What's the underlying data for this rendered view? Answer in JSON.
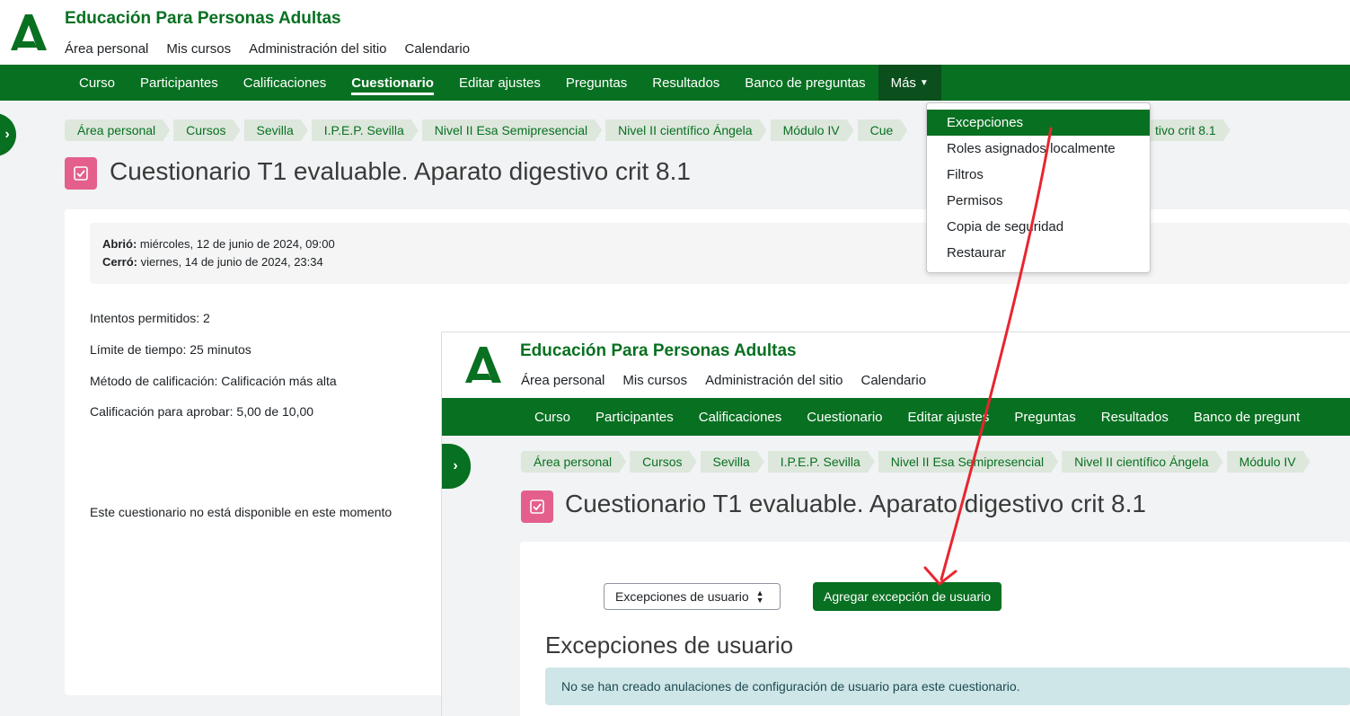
{
  "site": {
    "title": "Educación Para Personas Adultas"
  },
  "topnav": [
    "Área personal",
    "Mis cursos",
    "Administración del sitio",
    "Calendario"
  ],
  "secnav": {
    "items": [
      "Curso",
      "Participantes",
      "Calificaciones",
      "Cuestionario",
      "Editar ajustes",
      "Preguntas",
      "Resultados",
      "Banco de preguntas"
    ],
    "more": "Más"
  },
  "breadcrumb": [
    "Área personal",
    "Cursos",
    "Sevilla",
    "I.P.E.P. Sevilla",
    "Nivel II Esa Semipresencial",
    "Nivel II científico Ángela",
    "Módulo IV",
    "Cue",
    "tivo crit 8.1"
  ],
  "page": {
    "title": "Cuestionario T1 evaluable. Aparato digestivo crit 8.1"
  },
  "dates": {
    "opened_label": "Abrió:",
    "opened_value": " miércoles, 12 de junio de 2024, 09:00",
    "closed_label": "Cerró:",
    "closed_value": " viernes, 14 de junio de 2024, 23:34"
  },
  "info": {
    "attempts": "Intentos permitidos: 2",
    "time_limit": "Límite de tiempo: 25 minutos",
    "grading_method": "Método de calificación: Calificación más alta",
    "pass_grade": "Calificación para aprobar: 5,00 de 10,00",
    "unavailable": "Este cuestionario no está disponible en este momento"
  },
  "dropdown": [
    "Excepciones",
    "Roles asignados localmente",
    "Filtros",
    "Permisos",
    "Copia de seguridad",
    "Restaurar"
  ],
  "inset": {
    "secnav": [
      "Curso",
      "Participantes",
      "Calificaciones",
      "Cuestionario",
      "Editar ajustes",
      "Preguntas",
      "Resultados",
      "Banco de pregunt"
    ],
    "breadcrumb": [
      "Área personal",
      "Cursos",
      "Sevilla",
      "I.P.E.P. Sevilla",
      "Nivel II Esa Semipresencial",
      "Nivel II científico Ángela",
      "Módulo IV"
    ],
    "select_value": "Excepciones de usuario",
    "add_button": "Agregar excepción de usuario",
    "heading": "Excepciones de usuario",
    "alert": "No se han creado anulaciones de configuración de usuario para este cuestionario."
  },
  "colors": {
    "brand": "#087021",
    "quiz_icon": "#e45f8c",
    "arrow": "#e8252f"
  }
}
